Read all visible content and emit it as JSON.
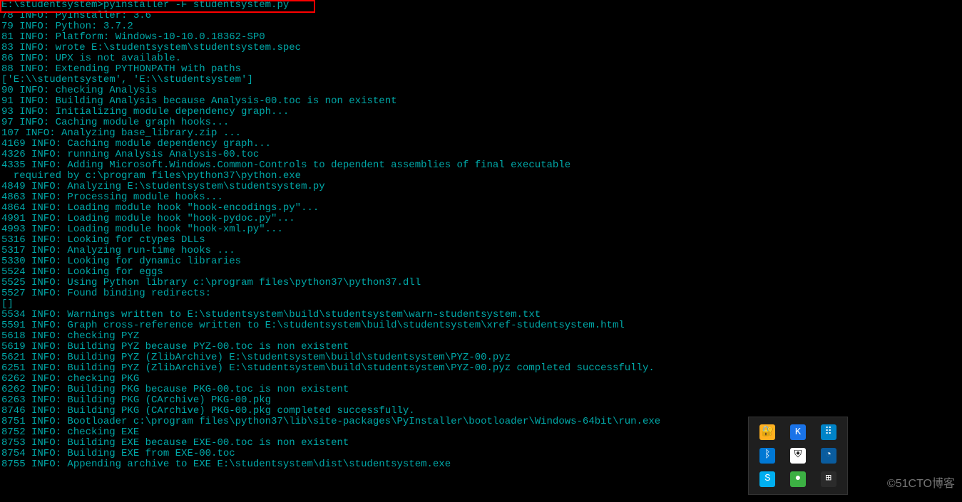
{
  "terminal": {
    "lines": [
      "E:\\studentsystem>pyinstaller -F studentsystem.py",
      "78 INFO: PyInstaller: 3.6",
      "79 INFO: Python: 3.7.2",
      "81 INFO: Platform: Windows-10-10.0.18362-SP0",
      "83 INFO: wrote E:\\studentsystem\\studentsystem.spec",
      "86 INFO: UPX is not available.",
      "88 INFO: Extending PYTHONPATH with paths",
      "['E:\\\\studentsystem', 'E:\\\\studentsystem']",
      "90 INFO: checking Analysis",
      "91 INFO: Building Analysis because Analysis-00.toc is non existent",
      "93 INFO: Initializing module dependency graph...",
      "97 INFO: Caching module graph hooks...",
      "107 INFO: Analyzing base_library.zip ...",
      "4169 INFO: Caching module dependency graph...",
      "4326 INFO: running Analysis Analysis-00.toc",
      "4335 INFO: Adding Microsoft.Windows.Common-Controls to dependent assemblies of final executable",
      "  required by c:\\program files\\python37\\python.exe",
      "4849 INFO: Analyzing E:\\studentsystem\\studentsystem.py",
      "4863 INFO: Processing module hooks...",
      "4864 INFO: Loading module hook \"hook-encodings.py\"...",
      "4991 INFO: Loading module hook \"hook-pydoc.py\"...",
      "4993 INFO: Loading module hook \"hook-xml.py\"...",
      "5316 INFO: Looking for ctypes DLLs",
      "5317 INFO: Analyzing run-time hooks ...",
      "5330 INFO: Looking for dynamic libraries",
      "5524 INFO: Looking for eggs",
      "5525 INFO: Using Python library c:\\program files\\python37\\python37.dll",
      "5527 INFO: Found binding redirects:",
      "[]",
      "5534 INFO: Warnings written to E:\\studentsystem\\build\\studentsystem\\warn-studentsystem.txt",
      "5591 INFO: Graph cross-reference written to E:\\studentsystem\\build\\studentsystem\\xref-studentsystem.html",
      "5618 INFO: checking PYZ",
      "5619 INFO: Building PYZ because PYZ-00.toc is non existent",
      "5621 INFO: Building PYZ (ZlibArchive) E:\\studentsystem\\build\\studentsystem\\PYZ-00.pyz",
      "6251 INFO: Building PYZ (ZlibArchive) E:\\studentsystem\\build\\studentsystem\\PYZ-00.pyz completed successfully.",
      "6262 INFO: checking PKG",
      "6262 INFO: Building PKG because PKG-00.toc is non existent",
      "6263 INFO: Building PKG (CArchive) PKG-00.pkg",
      "8746 INFO: Building PKG (CArchive) PKG-00.pkg completed successfully.",
      "8751 INFO: Bootloader c:\\program files\\python37\\lib\\site-packages\\PyInstaller\\bootloader\\Windows-64bit\\run.exe",
      "8752 INFO: checking EXE",
      "8753 INFO: Building EXE because EXE-00.toc is non existent",
      "8754 INFO: Building EXE from EXE-00.toc",
      "8755 INFO: Appending archive to EXE E:\\studentsystem\\dist\\studentsystem.exe"
    ]
  },
  "tray": {
    "icons": [
      {
        "name": "security-icon",
        "glyph": "🔐",
        "cls": "ic-yellow"
      },
      {
        "name": "k-app-icon",
        "glyph": "K",
        "cls": "ic-blue"
      },
      {
        "name": "grid-icon",
        "glyph": "⠿",
        "cls": "ic-teal"
      },
      {
        "name": "bluetooth-icon",
        "glyph": "ᛒ",
        "cls": "ic-blue2"
      },
      {
        "name": "defender-icon",
        "glyph": "⛨",
        "cls": "ic-shield"
      },
      {
        "name": "edge-icon",
        "glyph": "◔",
        "cls": "ic-edge"
      },
      {
        "name": "skype-icon",
        "glyph": "S",
        "cls": "ic-skype"
      },
      {
        "name": "wechat-icon",
        "glyph": "●",
        "cls": "ic-green"
      },
      {
        "name": "windows-icon",
        "glyph": "⊞",
        "cls": "ic-win"
      }
    ]
  },
  "watermark": "©51CTO博客"
}
